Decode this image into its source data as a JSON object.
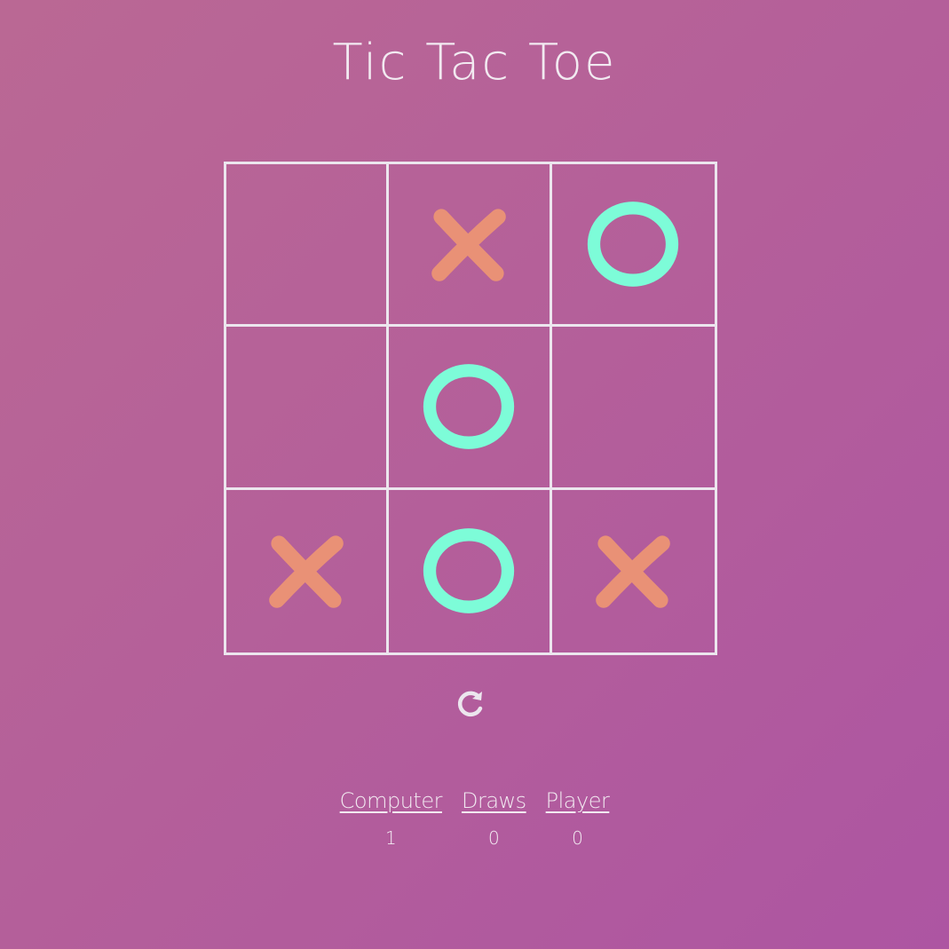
{
  "title": "Tic Tac Toe",
  "colors": {
    "x_mark": "#e99176",
    "o_mark": "#7dfcd8",
    "grid_line": "#ece6ee",
    "text": "#f2eaf1"
  },
  "board": {
    "cells": [
      "",
      "X",
      "O",
      "",
      "O",
      "",
      "X",
      "O",
      "X"
    ]
  },
  "restart": {
    "icon": "restart-icon"
  },
  "scoreboard": {
    "computer": {
      "label": "Computer",
      "value": "1"
    },
    "draws": {
      "label": "Draws",
      "value": "0"
    },
    "player": {
      "label": "Player",
      "value": "0"
    }
  }
}
